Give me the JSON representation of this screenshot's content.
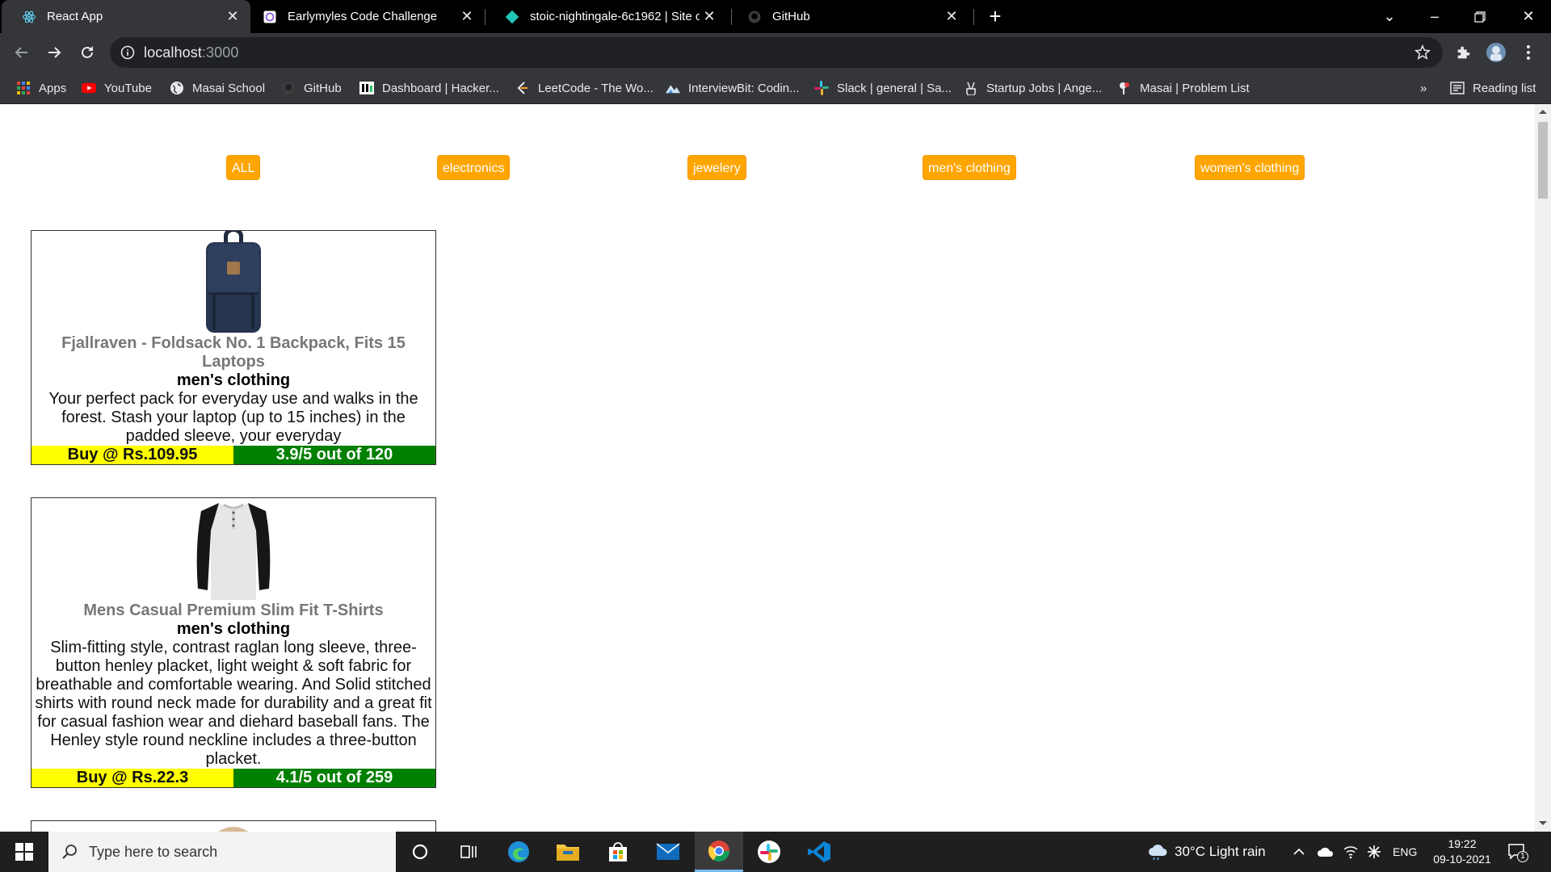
{
  "browser": {
    "tabs": [
      {
        "title": "React App",
        "icon": "react-icon",
        "active": true
      },
      {
        "title": "Earlymyles Code Challenge",
        "icon": "codesandbox-icon",
        "active": false
      },
      {
        "title": "stoic-nightingale-6c1962 | Site o",
        "icon": "netlify-icon",
        "active": false
      },
      {
        "title": "GitHub",
        "icon": "github-icon",
        "active": false
      }
    ],
    "url_host": "localhost",
    "url_port": ":3000",
    "bookmarks": [
      {
        "label": "Apps",
        "icon": "apps-grid-icon"
      },
      {
        "label": "YouTube",
        "icon": "youtube-icon"
      },
      {
        "label": "Masai School",
        "icon": "globe-icon"
      },
      {
        "label": "GitHub",
        "icon": "github-icon"
      },
      {
        "label": "Dashboard | Hacker...",
        "icon": "hackerrank-icon"
      },
      {
        "label": "LeetCode - The Wo...",
        "icon": "leetcode-icon"
      },
      {
        "label": "InterviewBit: Codin...",
        "icon": "interviewbit-icon"
      },
      {
        "label": "Slack | general | Sa...",
        "icon": "slack-icon"
      },
      {
        "label": "Startup Jobs | Ange...",
        "icon": "angellist-icon"
      },
      {
        "label": "Masai | Problem List",
        "icon": "masai-icon"
      }
    ],
    "bookmarks_overflow": "»",
    "reading_list": "Reading list"
  },
  "filters": [
    "ALL",
    "electronics",
    "jewelery",
    "men's clothing",
    "women's clothing"
  ],
  "products": [
    {
      "title": "Fjallraven - Foldsack No. 1 Backpack, Fits 15 Laptops",
      "category": "men's clothing",
      "description": "Your perfect pack for everyday use and walks in the forest. Stash your laptop (up to 15 inches) in the padded sleeve, your everyday",
      "price": "Buy @ Rs.109.95",
      "rating": "3.9/5 out of 120",
      "image": "backpack-image"
    },
    {
      "title": "Mens Casual Premium Slim Fit T-Shirts",
      "category": "men's clothing",
      "description": "Slim-fitting style, contrast raglan long sleeve, three-button henley placket, light weight & soft fabric for breathable and comfortable wearing. And Solid stitched shirts with round neck made for durability and a great fit for casual fashion wear and diehard baseball fans. The Henley style round neckline includes a three-button placket.",
      "price": "Buy @ Rs.22.3",
      "rating": "4.1/5 out of 259",
      "image": "tshirt-image"
    }
  ],
  "taskbar": {
    "search_placeholder": "Type here to search",
    "weather": "30°C  Light rain",
    "language": "ENG",
    "time": "19:22",
    "date": "09-10-2021",
    "notification_count": "1"
  },
  "colors": {
    "filter_button_bg": "#ffa500",
    "price_bg": "#ffff00",
    "rating_bg": "#008000",
    "browser_dark": "#35363a"
  }
}
